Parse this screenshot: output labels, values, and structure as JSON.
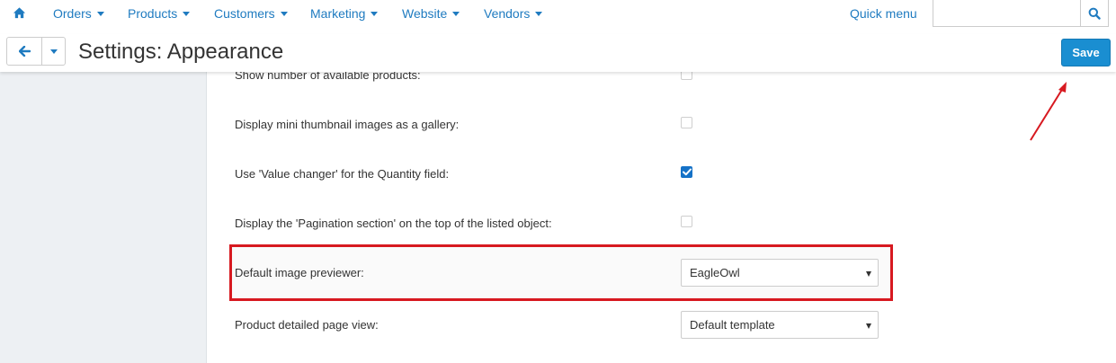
{
  "topnav": {
    "items": [
      {
        "label": "Orders"
      },
      {
        "label": "Products"
      },
      {
        "label": "Customers"
      },
      {
        "label": "Marketing"
      },
      {
        "label": "Website"
      },
      {
        "label": "Vendors"
      }
    ],
    "quick_menu": "Quick menu",
    "search": {
      "value": "",
      "placeholder": ""
    }
  },
  "header": {
    "title": "Settings: Appearance",
    "save_label": "Save"
  },
  "settings": {
    "rows": [
      {
        "label": "Show number of available products:",
        "checked": false
      },
      {
        "label": "Display mini thumbnail images as a gallery:",
        "checked": false
      },
      {
        "label": "Use 'Value changer' for the Quantity field:",
        "checked": true
      },
      {
        "label": "Display the 'Pagination section' on the top of the listed object:",
        "checked": false
      }
    ],
    "image_previewer": {
      "label": "Default image previewer:",
      "value": "EagleOwl"
    },
    "product_view": {
      "label": "Product detailed page view:",
      "value": "Default template"
    }
  },
  "colors": {
    "accent": "#1f7bc0",
    "save_button": "#1a8ed1",
    "highlight": "#d71920"
  }
}
